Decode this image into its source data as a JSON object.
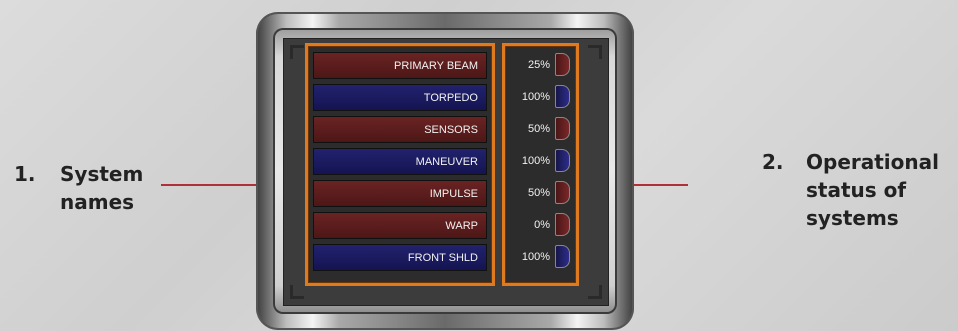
{
  "annotations": {
    "left": {
      "number": "1.",
      "text_line1": "System",
      "text_line2": "names"
    },
    "right": {
      "number": "2.",
      "text_line1": "Operational",
      "text_line2": "status of",
      "text_line3": "systems"
    }
  },
  "colors": {
    "red_row": "#5a1e1e",
    "blue_row": "#1c1c62",
    "panel_border": "#e07a1f",
    "leader_line": "#b0303a"
  },
  "systems": [
    {
      "name": "PRIMARY BEAM",
      "status": "25%",
      "color": "red"
    },
    {
      "name": "TORPEDO",
      "status": "100%",
      "color": "blue"
    },
    {
      "name": "SENSORS",
      "status": "50%",
      "color": "red"
    },
    {
      "name": "MANEUVER",
      "status": "100%",
      "color": "blue"
    },
    {
      "name": "IMPULSE",
      "status": "50%",
      "color": "red"
    },
    {
      "name": "WARP",
      "status": "0%",
      "color": "red"
    },
    {
      "name": "FRONT SHLD",
      "status": "100%",
      "color": "blue"
    }
  ]
}
